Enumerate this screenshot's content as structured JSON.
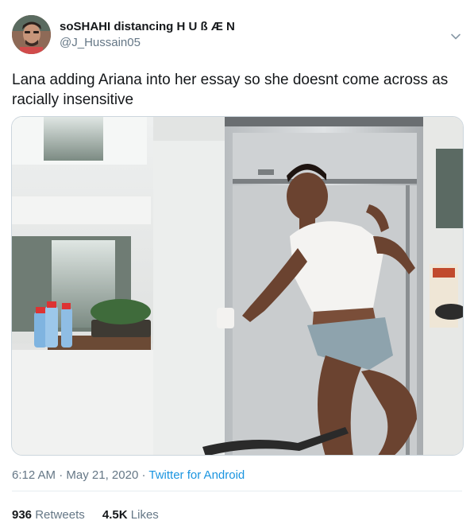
{
  "author": {
    "display_name": "soSHAHI distancing H U ß Æ N",
    "handle": "@J_Hussain05"
  },
  "tweet": {
    "text": "Lana adding Ariana into her essay so she doesnt come across as racially insensitive"
  },
  "media": {
    "type": "video-still",
    "description": "woman in a kitchen in front of a stainless steel refrigerator"
  },
  "meta": {
    "time": "6:12 AM",
    "separator": "·",
    "date": "May 21, 2020",
    "source": "Twitter for Android"
  },
  "stats": {
    "retweets_count": "936",
    "retweets_label": "Retweets",
    "likes_count": "4.5K",
    "likes_label": "Likes"
  },
  "colors": {
    "link": "#1b95e0",
    "secondary_text": "#657786",
    "divider": "#e6ecf0"
  },
  "icons": {
    "menu": "chevron-down-icon"
  }
}
